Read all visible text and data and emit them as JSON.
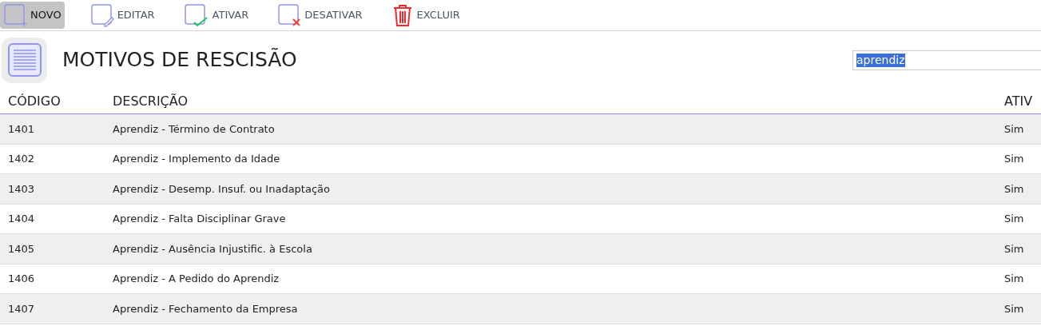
{
  "toolbar": [
    {
      "kind": "new",
      "label": "NOVO",
      "selected": true
    },
    {
      "kind": "edit",
      "label": "EDITAR",
      "selected": false
    },
    {
      "kind": "activate",
      "label": "ATIVAR",
      "selected": false
    },
    {
      "kind": "deactivate",
      "label": "DESATIVAR",
      "selected": false
    },
    {
      "kind": "delete",
      "label": "EXCLUIR",
      "selected": false
    }
  ],
  "page_title": "MOTIVOS DE RESCISÃO",
  "search": {
    "value": "aprendiz"
  },
  "table": {
    "columns": [
      "CÓDIGO",
      "DESCRIÇÃO",
      "ATIV"
    ],
    "rows": [
      [
        "1401",
        "Aprendiz - Término de Contrato",
        "Sim"
      ],
      [
        "1402",
        "Aprendiz - Implemento da Idade",
        "Sim"
      ],
      [
        "1403",
        "Aprendiz - Desemp. Insuf. ou Inadaptação",
        "Sim"
      ],
      [
        "1404",
        "Aprendiz - Falta Disciplinar Grave",
        "Sim"
      ],
      [
        "1405",
        "Aprendiz - Ausência Injustific. à Escola",
        "Sim"
      ],
      [
        "1406",
        "Aprendiz - A Pedido do Aprendiz",
        "Sim"
      ],
      [
        "1407",
        "Aprendiz - Fechamento da Empresa",
        "Sim"
      ]
    ]
  }
}
